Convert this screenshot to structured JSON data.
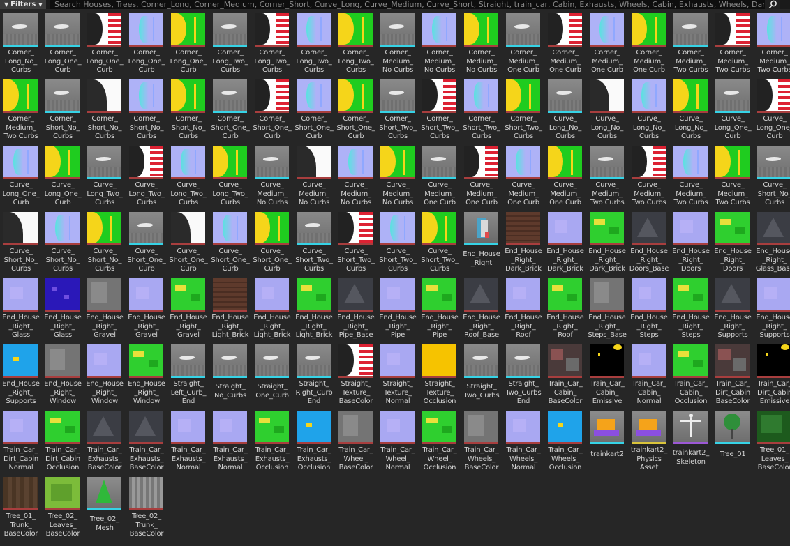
{
  "toolbar": {
    "filters_label": "Filters",
    "search_value": "Search Houses, Trees, Corner_Long, Corner_Medium, Corner_Short, Curve_Long, Curve_Medium, Curve_Short, Straight, train_car, Cabin, Exhausts, Wheels, Cabin, Exhausts, Wheels, Dark_Brick, Light_Brick, Roof, Steps, Supports, Window"
  },
  "colors": {
    "texture_bar": "#a83e3e",
    "mesh_bar": "#36d3e6",
    "physics_bar": "#dac43a",
    "skeleton_bar": "#9c58d6"
  },
  "assets": [
    {
      "label": "Corner_\nLong_No_\nCurbs",
      "type": "mesh",
      "thumb": "mesh"
    },
    {
      "label": "Corner_\nLong_One_\nCurb",
      "type": "mesh",
      "thumb": "mesh"
    },
    {
      "label": "Corner_\nLong_One_\nCurb",
      "type": "tex",
      "thumb": "stripes"
    },
    {
      "label": "Corner_\nLong_One_\nCurb",
      "type": "tex",
      "thumb": "normal"
    },
    {
      "label": "Corner_\nLong_One_\nCurb",
      "type": "tex",
      "thumb": "yellowgreen"
    },
    {
      "label": "Corner_\nLong_Two_\nCurbs",
      "type": "mesh",
      "thumb": "mesh"
    },
    {
      "label": "Corner_\nLong_Two_\nCurbs",
      "type": "tex",
      "thumb": "stripes"
    },
    {
      "label": "Corner_\nLong_Two_\nCurbs",
      "type": "tex",
      "thumb": "normal"
    },
    {
      "label": "Corner_\nLong_Two_\nCurbs",
      "type": "tex",
      "thumb": "yellowgreen"
    },
    {
      "label": "Corner_\nMedium_\nNo Curbs",
      "type": "mesh",
      "thumb": "mesh"
    },
    {
      "label": "Corner_\nMedium_\nNo Curbs",
      "type": "tex",
      "thumb": "normal"
    },
    {
      "label": "Corner_\nMedium_\nNo Curbs",
      "type": "tex",
      "thumb": "yellowgreen"
    },
    {
      "label": "Corner_\nMedium_\nOne Curb",
      "type": "mesh",
      "thumb": "mesh"
    },
    {
      "label": "Corner_\nMedium_\nOne Curb",
      "type": "tex",
      "thumb": "stripes"
    },
    {
      "label": "Corner_\nMedium_\nOne Curb",
      "type": "tex",
      "thumb": "normal"
    },
    {
      "label": "Corner_\nMedium_\nOne Curb",
      "type": "tex",
      "thumb": "yellowgreen"
    },
    {
      "label": "Corner_\nMedium_\nTwo Curbs",
      "type": "mesh",
      "thumb": "mesh"
    },
    {
      "label": "Corner_\nMedium_\nTwo Curbs",
      "type": "tex",
      "thumb": "stripes"
    },
    {
      "label": "Corner_\nMedium_\nTwo Curbs",
      "type": "tex",
      "thumb": "normal"
    },
    {
      "label": "Corner_\nMedium_\nTwo Curbs",
      "type": "tex",
      "thumb": "yellowgreen"
    },
    {
      "label": "Corner_\nShort_No_\nCurbs",
      "type": "mesh",
      "thumb": "mesh"
    },
    {
      "label": "Corner_\nShort_No_\nCurbs",
      "type": "tex",
      "thumb": "dark"
    },
    {
      "label": "Corner_\nShort_No_\nCurbs",
      "type": "tex",
      "thumb": "normal"
    },
    {
      "label": "Corner_\nShort_No_\nCurbs",
      "type": "tex",
      "thumb": "yellowgreen"
    },
    {
      "label": "Corner_\nShort_One_\nCurb",
      "type": "mesh",
      "thumb": "mesh"
    },
    {
      "label": "Corner_\nShort_One_\nCurb",
      "type": "tex",
      "thumb": "stripes"
    },
    {
      "label": "Corner_\nShort_One_\nCurb",
      "type": "tex",
      "thumb": "normal"
    },
    {
      "label": "Corner_\nShort_One_\nCurb",
      "type": "tex",
      "thumb": "yellowgreen"
    },
    {
      "label": "Corner_\nShort_Two_\nCurbs",
      "type": "mesh",
      "thumb": "mesh"
    },
    {
      "label": "Corner_\nShort_Two_\nCurbs",
      "type": "tex",
      "thumb": "stripes"
    },
    {
      "label": "Corner_\nShort_Two_\nCurbs",
      "type": "tex",
      "thumb": "normal"
    },
    {
      "label": "Corner_\nShort_Two_\nCurbs",
      "type": "tex",
      "thumb": "yellowgreen"
    },
    {
      "label": "Curve_\nLong_No_\nCurbs",
      "type": "mesh",
      "thumb": "mesh"
    },
    {
      "label": "Curve_\nLong_No_\nCurbs",
      "type": "tex",
      "thumb": "dark"
    },
    {
      "label": "Curve_\nLong_No_\nCurbs",
      "type": "tex",
      "thumb": "normal"
    },
    {
      "label": "Curve_\nLong_No_\nCurbs",
      "type": "tex",
      "thumb": "yellowgreen"
    },
    {
      "label": "Curve_\nLong_One_\nCurb",
      "type": "mesh",
      "thumb": "mesh"
    },
    {
      "label": "Curve_\nLong_One_\nCurb",
      "type": "tex",
      "thumb": "stripes"
    },
    {
      "label": "Curve_\nLong_One_\nCurb",
      "type": "tex",
      "thumb": "normal"
    },
    {
      "label": "Curve_\nLong_One_\nCurb",
      "type": "tex",
      "thumb": "yellowgreen"
    },
    {
      "label": "Curve_\nLong_Two_\nCurbs",
      "type": "mesh",
      "thumb": "mesh"
    },
    {
      "label": "Curve_\nLong_Two_\nCurbs",
      "type": "tex",
      "thumb": "stripes"
    },
    {
      "label": "Curve_\nLong_Two_\nCurbs",
      "type": "tex",
      "thumb": "normal"
    },
    {
      "label": "Curve_\nLong_Two_\nCurbs",
      "type": "tex",
      "thumb": "yellowgreen"
    },
    {
      "label": "Curve_\nMedium_\nNo Curbs",
      "type": "mesh",
      "thumb": "mesh"
    },
    {
      "label": "Curve_\nMedium_\nNo Curbs",
      "type": "tex",
      "thumb": "dark"
    },
    {
      "label": "Curve_\nMedium_\nNo Curbs",
      "type": "tex",
      "thumb": "normal"
    },
    {
      "label": "Curve_\nMedium_\nNo Curbs",
      "type": "tex",
      "thumb": "yellowgreen"
    },
    {
      "label": "Curve_\nMedium_\nOne Curb",
      "type": "mesh",
      "thumb": "mesh"
    },
    {
      "label": "Curve_\nMedium_\nOne Curb",
      "type": "tex",
      "thumb": "stripes"
    },
    {
      "label": "Curve_\nMedium_\nOne Curb",
      "type": "tex",
      "thumb": "normal"
    },
    {
      "label": "Curve_\nMedium_\nOne Curb",
      "type": "tex",
      "thumb": "yellowgreen"
    },
    {
      "label": "Curve_\nMedium_\nTwo Curbs",
      "type": "mesh",
      "thumb": "mesh"
    },
    {
      "label": "Curve_\nMedium_\nTwo Curbs",
      "type": "tex",
      "thumb": "stripes"
    },
    {
      "label": "Curve_\nMedium_\nTwo Curbs",
      "type": "tex",
      "thumb": "normal"
    },
    {
      "label": "Curve_\nMedium_\nTwo Curbs",
      "type": "tex",
      "thumb": "yellowgreen"
    },
    {
      "label": "Curve_\nShort_No_\nCurbs",
      "type": "mesh",
      "thumb": "mesh"
    },
    {
      "label": "Curve_\nShort_No_\nCurbs",
      "type": "tex",
      "thumb": "dark"
    },
    {
      "label": "Curve_\nShort_No_\nCurbs",
      "type": "tex",
      "thumb": "normal"
    },
    {
      "label": "Curve_\nShort_No_\nCurbs",
      "type": "tex",
      "thumb": "yellowgreen"
    },
    {
      "label": "Curve_\nShort_One_\nCurb",
      "type": "mesh",
      "thumb": "mesh"
    },
    {
      "label": "Curve_\nShort_One_\nCurb",
      "type": "tex",
      "thumb": "dark"
    },
    {
      "label": "Curve_\nShort_One_\nCurb",
      "type": "tex",
      "thumb": "normal"
    },
    {
      "label": "Curve_\nShort_One_\nCurb",
      "type": "tex",
      "thumb": "yellowgreen"
    },
    {
      "label": "Curve_\nShort_Two_\nCurbs",
      "type": "mesh",
      "thumb": "mesh"
    },
    {
      "label": "Curve_\nShort_Two_\nCurbs",
      "type": "tex",
      "thumb": "stripes"
    },
    {
      "label": "Curve_\nShort_Two_\nCurbs",
      "type": "tex",
      "thumb": "normal"
    },
    {
      "label": "Curve_\nShort_Two_\nCurbs",
      "type": "tex",
      "thumb": "yellowgreen"
    },
    {
      "label": "End_House\n_Right",
      "type": "mesh",
      "thumb": "house3d"
    },
    {
      "label": "End_House\n_Right_\nDark_Brick",
      "type": "tex",
      "thumb": "brick"
    },
    {
      "label": "End_House\n_Right_\nDark_Brick",
      "type": "tex",
      "thumb": "lavender"
    },
    {
      "label": "End_House\n_Right_\nDark_Brick",
      "type": "tex",
      "thumb": "occl"
    },
    {
      "label": "End_House\n_Right_\nDoors_Base",
      "type": "tex",
      "thumb": "darkgray"
    },
    {
      "label": "End_House\n_Right_\nDoors",
      "type": "tex",
      "thumb": "lavender"
    },
    {
      "label": "End_House\n_Right_\nDoors",
      "type": "tex",
      "thumb": "occl"
    },
    {
      "label": "End_House\n_Right_\nGlass_Base",
      "type": "tex",
      "thumb": "darkgray"
    },
    {
      "label": "End_House\n_Right_\nGlass",
      "type": "tex",
      "thumb": "lavender"
    },
    {
      "label": "End_House\n_Right_\nGlass",
      "type": "tex",
      "thumb": "navy"
    },
    {
      "label": "End_House\n_Right_\nGravel",
      "type": "tex",
      "thumb": "gray"
    },
    {
      "label": "End_House\n_Right_\nGravel",
      "type": "tex",
      "thumb": "lavender"
    },
    {
      "label": "End_House\n_Right_\nGravel",
      "type": "tex",
      "thumb": "occl"
    },
    {
      "label": "End_House\n_Right_\nLight_Brick",
      "type": "tex",
      "thumb": "brick"
    },
    {
      "label": "End_House\n_Right_\nLight_Brick",
      "type": "tex",
      "thumb": "lavender"
    },
    {
      "label": "End_House\n_Right_\nLight_Brick",
      "type": "tex",
      "thumb": "occl"
    },
    {
      "label": "End_House\n_Right_\nPipe_Base",
      "type": "tex",
      "thumb": "darkgray"
    },
    {
      "label": "End_House\n_Right_\nPipe",
      "type": "tex",
      "thumb": "lavender"
    },
    {
      "label": "End_House\n_Right_\nPipe",
      "type": "tex",
      "thumb": "occl"
    },
    {
      "label": "End_House\n_Right_\nRoof_Base",
      "type": "tex",
      "thumb": "darkgray"
    },
    {
      "label": "End_House\n_Right_\nRoof",
      "type": "tex",
      "thumb": "lavender"
    },
    {
      "label": "End_House\n_Right_\nRoof",
      "type": "tex",
      "thumb": "occl"
    },
    {
      "label": "End_House\n_Right_\nSteps_Base",
      "type": "tex",
      "thumb": "gray"
    },
    {
      "label": "End_House\n_Right_\nSteps",
      "type": "tex",
      "thumb": "lavender"
    },
    {
      "label": "End_House\n_Right_\nSteps",
      "type": "tex",
      "thumb": "occl"
    },
    {
      "label": "End_House\n_Right_\nSupports",
      "type": "tex",
      "thumb": "darkgray"
    },
    {
      "label": "End_House\n_Right_\nSupports",
      "type": "tex",
      "thumb": "lavender"
    },
    {
      "label": "End_House\n_Right_\nSupports",
      "type": "tex",
      "thumb": "cyan"
    },
    {
      "label": "End_House\n_Right_\nWindow",
      "type": "tex",
      "thumb": "gray"
    },
    {
      "label": "End_House\n_Right_\nWindow",
      "type": "tex",
      "thumb": "lavender"
    },
    {
      "label": "End_House\n_Right_\nWindow",
      "type": "tex",
      "thumb": "occl"
    },
    {
      "label": "Straight_\nLeft_Curb_\nEnd",
      "type": "mesh",
      "thumb": "mesh"
    },
    {
      "label": "Straight_\nNo_Curbs",
      "type": "mesh",
      "thumb": "mesh"
    },
    {
      "label": "Straight_\nOne_Curb",
      "type": "mesh",
      "thumb": "mesh"
    },
    {
      "label": "Straight_\nRight_Curb\nEnd",
      "type": "mesh",
      "thumb": "mesh"
    },
    {
      "label": "Straight_\nTexture_\nBaseColor",
      "type": "tex",
      "thumb": "stripes"
    },
    {
      "label": "Straight_\nTexture_\nNormal",
      "type": "tex",
      "thumb": "lavender"
    },
    {
      "label": "Straight_\nTexture_\nOcclusion",
      "type": "tex",
      "thumb": "yellow"
    },
    {
      "label": "Straight_\nTwo_Curbs",
      "type": "mesh",
      "thumb": "mesh"
    },
    {
      "label": "Straight_\nTwo_Curbs\nEnd",
      "type": "mesh",
      "thumb": "mesh"
    },
    {
      "label": "Train_Car_\nCabin_\nBaseColor",
      "type": "tex",
      "thumb": "train"
    },
    {
      "label": "Train_Car_\nCabin_\nEmissive",
      "type": "tex",
      "thumb": "black"
    },
    {
      "label": "Train_Car_\nCabin_\nNormal",
      "type": "tex",
      "thumb": "lavender"
    },
    {
      "label": "Train_Car_\nCabin_\nOcclusion",
      "type": "tex",
      "thumb": "occl"
    },
    {
      "label": "Train_Car_\nDirt_Cabin\nBaseColor",
      "type": "tex",
      "thumb": "train"
    },
    {
      "label": "Train_Car_\nDirt_Cabin\nEmissive",
      "type": "tex",
      "thumb": "black"
    },
    {
      "label": "Train_Car_\nDirt_Cabin\nNormal",
      "type": "tex",
      "thumb": "lavender"
    },
    {
      "label": "Train_Car_\nDirt_Cabin\nOcclusion",
      "type": "tex",
      "thumb": "occl"
    },
    {
      "label": "Train_Car_\nExhausts_\nBaseColor",
      "type": "tex",
      "thumb": "darkgray"
    },
    {
      "label": "Train_Car_\nExhausts_\nBaseColor",
      "type": "tex",
      "thumb": "darkgray"
    },
    {
      "label": "Train_Car_\nExhausts_\nNormal",
      "type": "tex",
      "thumb": "lavender"
    },
    {
      "label": "Train_Car_\nExhausts_\nNormal",
      "type": "tex",
      "thumb": "lavender"
    },
    {
      "label": "Train_Car_\nExhausts_\nOcclusion",
      "type": "tex",
      "thumb": "occl"
    },
    {
      "label": "Train_Car_\nExhausts_\nOcclusion",
      "type": "tex",
      "thumb": "cyan"
    },
    {
      "label": "Train_Car_\nWheel_\nBaseColor",
      "type": "tex",
      "thumb": "gray"
    },
    {
      "label": "Train_Car_\nWheel_\nNormal",
      "type": "tex",
      "thumb": "lavender"
    },
    {
      "label": "Train_Car_\nWheel_\nOcclusion",
      "type": "tex",
      "thumb": "occl"
    },
    {
      "label": "Train_Car_\nWheels_\nBaseColor",
      "type": "tex",
      "thumb": "gray"
    },
    {
      "label": "Train_Car_\nWheels_\nNormal",
      "type": "tex",
      "thumb": "lavender"
    },
    {
      "label": "Train_Car_\nWheels_\nOcclusion",
      "type": "tex",
      "thumb": "cyan"
    },
    {
      "label": "trainkart2",
      "type": "mesh",
      "thumb": "kart"
    },
    {
      "label": "trainkart2_\nPhysics\nAsset",
      "type": "physics",
      "thumb": "kart"
    },
    {
      "label": "trainkart2_\nSkeleton",
      "type": "skeleton",
      "thumb": "skeleton"
    },
    {
      "label": "Tree_01",
      "type": "mesh",
      "thumb": "tree3d"
    },
    {
      "label": "Tree_01_\nLeaves_\nBaseColor",
      "type": "tex",
      "thumb": "leaves"
    },
    {
      "label": "Tree_01_\nTrunk_\nBaseColor",
      "type": "tex",
      "thumb": "trunk"
    },
    {
      "label": "Tree_02_\nLeaves_\nBaseColor",
      "type": "tex",
      "thumb": "leaves2"
    },
    {
      "label": "Tree_02_\nMesh",
      "type": "mesh",
      "thumb": "cone"
    },
    {
      "label": "Tree_02_\nTrunk_\nBaseColor",
      "type": "tex",
      "thumb": "trunk2"
    }
  ]
}
